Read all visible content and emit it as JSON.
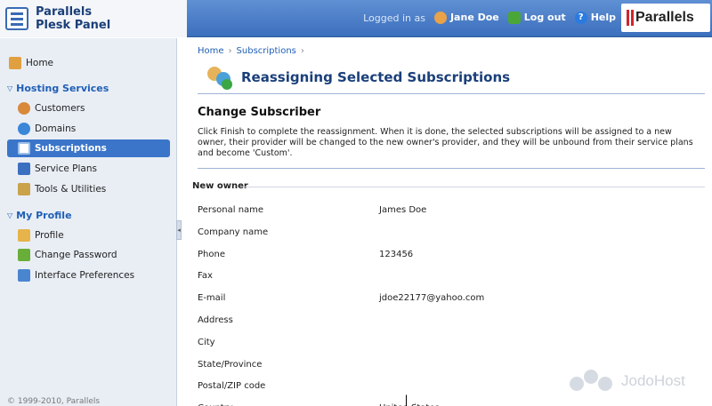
{
  "app": {
    "name_line1": "Parallels",
    "name_line2": "Plesk Panel",
    "brand": "Parallels"
  },
  "header": {
    "logged_in_as": "Logged in as",
    "user_name": "Jane Doe",
    "logout": "Log out",
    "help": "Help",
    "help_icon_glyph": "?"
  },
  "sidebar": {
    "home": "Home",
    "hosting_services": "Hosting Services",
    "customers": "Customers",
    "domains": "Domains",
    "subscriptions": "Subscriptions",
    "service_plans": "Service Plans",
    "tools": "Tools & Utilities",
    "my_profile": "My Profile",
    "profile": "Profile",
    "change_password": "Change Password",
    "interface_preferences": "Interface Preferences",
    "copyright": "© 1999-2010, Parallels"
  },
  "main": {
    "breadcrumb": {
      "home": "Home",
      "subscriptions": "Subscriptions",
      "sep": "›"
    },
    "title": "Reassigning Selected Subscriptions",
    "subheading": "Change Subscriber",
    "description": "Click Finish to complete the reassignment. When it is done, the selected subscriptions will be assigned to a new owner, their provider will be changed to the new owner's provider, and they will be unbound from their service plans and become 'Custom'.",
    "group_title": "New owner",
    "fields": [
      {
        "label": "Personal name",
        "value": "James Doe"
      },
      {
        "label": "Company name",
        "value": ""
      },
      {
        "label": "Phone",
        "value": "123456"
      },
      {
        "label": "Fax",
        "value": ""
      },
      {
        "label": "E-mail",
        "value": "jdoe22177@yahoo.com"
      },
      {
        "label": "Address",
        "value": ""
      },
      {
        "label": "City",
        "value": ""
      },
      {
        "label": "State/Province",
        "value": ""
      },
      {
        "label": "Postal/ZIP code",
        "value": ""
      },
      {
        "label": "Country",
        "value": "United States"
      }
    ]
  },
  "watermark": "JodoHost",
  "colors": {
    "header_blue": "#3c6fbd",
    "sidebar_bg": "#e9eef5",
    "active_nav": "#3b75c9",
    "title_blue": "#1a3f7a",
    "link_blue": "#1f5fb5"
  }
}
